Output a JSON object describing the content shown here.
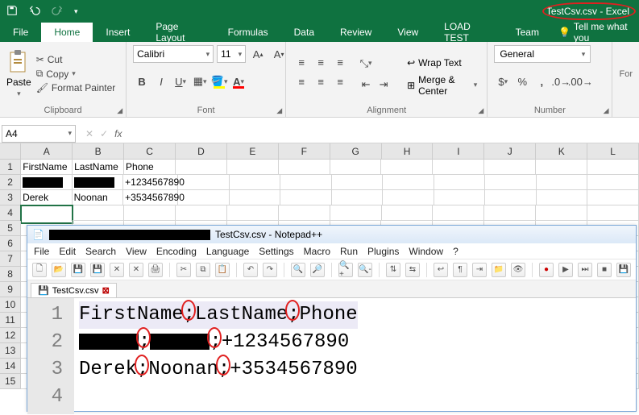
{
  "app": {
    "doc_title_part1": "TestCsv.csv",
    "doc_title_part2": " - Excel"
  },
  "tabs": [
    "File",
    "Home",
    "Insert",
    "Page Layout",
    "Formulas",
    "Data",
    "Review",
    "View",
    "LOAD TEST",
    "Team"
  ],
  "tell_me": "Tell me what you",
  "clipboard": {
    "paste": "Paste",
    "cut": "Cut",
    "copy": "Copy",
    "format_painter": "Format Painter",
    "group": "Clipboard"
  },
  "font": {
    "name": "Calibri",
    "size": "11",
    "group": "Font"
  },
  "alignment": {
    "wrap": "Wrap Text",
    "merge": "Merge & Center",
    "group": "Alignment"
  },
  "number": {
    "format": "General",
    "group": "Number"
  },
  "namebox": "A4",
  "columns": [
    "A",
    "B",
    "C",
    "D",
    "E",
    "F",
    "G",
    "H",
    "I",
    "J",
    "K",
    "L"
  ],
  "row_count": 15,
  "cells": {
    "r1": {
      "A": "FirstName",
      "B": "LastName",
      "C": "Phone"
    },
    "r2": {
      "C": "+1234567890"
    },
    "r3": {
      "A": "Derek",
      "B": "Noonan",
      "C": "+3534567890"
    }
  },
  "npp": {
    "title_mid": "TestCsv.csv - Notepad++",
    "menu": [
      "File",
      "Edit",
      "Search",
      "View",
      "Encoding",
      "Language",
      "Settings",
      "Macro",
      "Run",
      "Plugins",
      "Window",
      "?"
    ],
    "tab": "TestCsv.csv",
    "gutter": [
      "1",
      "2",
      "3",
      "4"
    ],
    "line1": {
      "a": "FirstName",
      "s": ";",
      "b": "LastName",
      "c": "Phone"
    },
    "line2": {
      "s": ";",
      "t": ";",
      "tail": "+1234567890"
    },
    "line3": {
      "a": "Derek",
      "s": ";",
      "b": "Noonan",
      "t": ";",
      "tail": "+3534567890"
    }
  }
}
